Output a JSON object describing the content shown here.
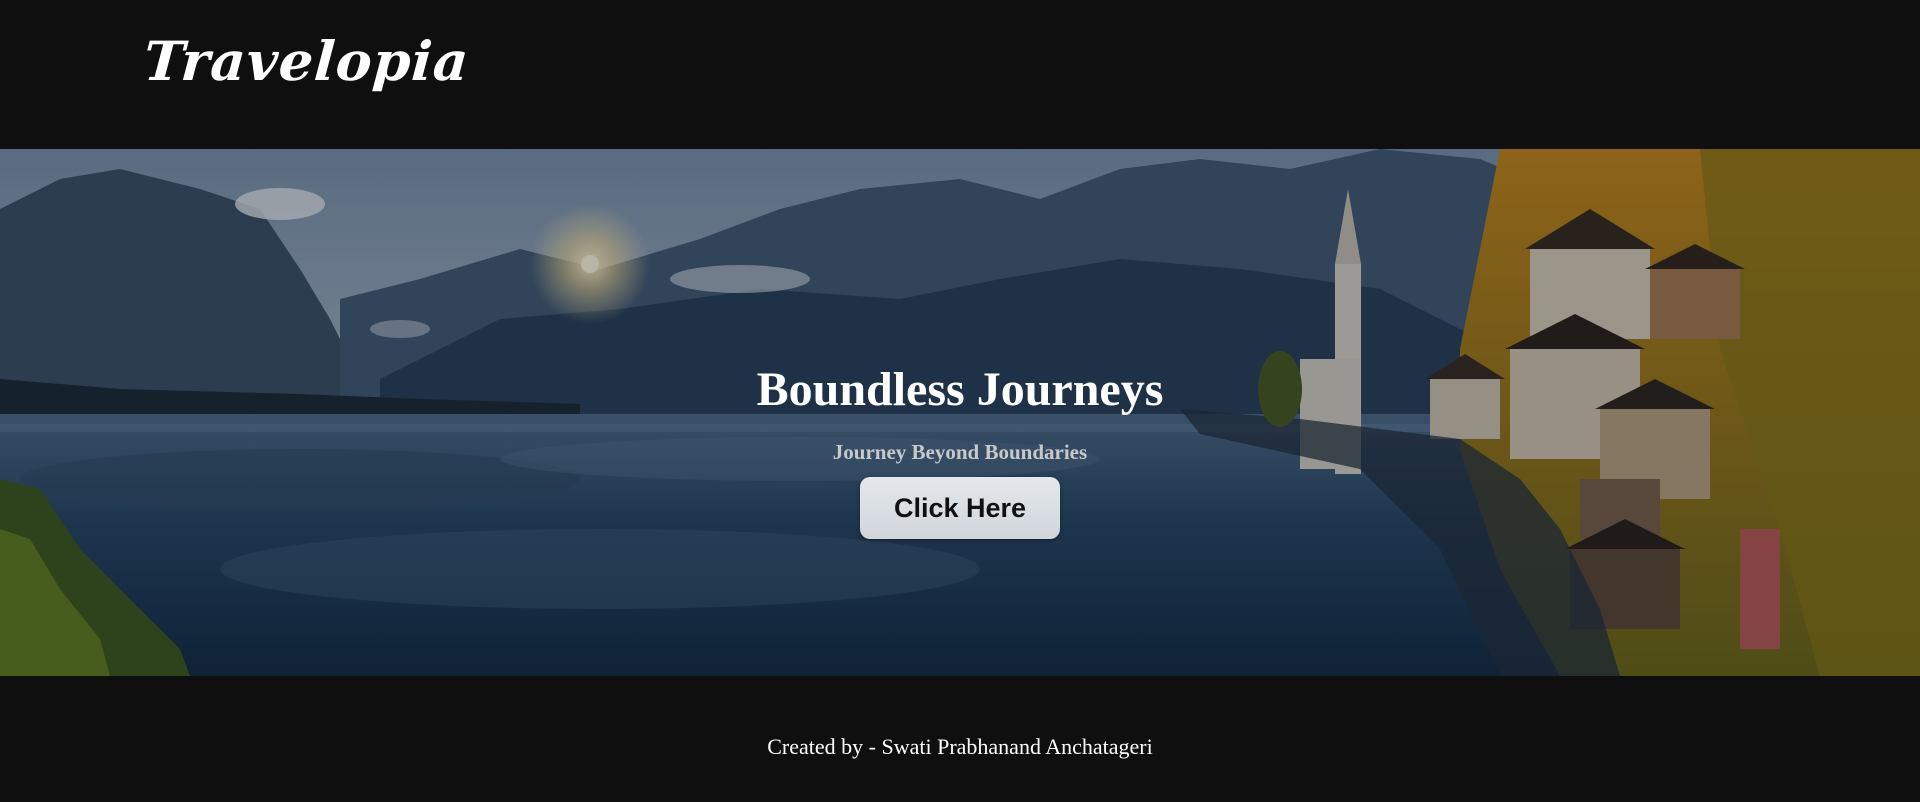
{
  "header": {
    "logo_text": "Travelopia"
  },
  "hero": {
    "title": "Boundless Journeys",
    "subtitle": "Journey Beyond Boundaries",
    "button_label": "Click Here",
    "background_image": "mountain-lake-village-landscape"
  },
  "footer": {
    "credit": "Created by - Swati Prabhanand Anchatageri"
  },
  "colors": {
    "page_background": "#0f0f0f",
    "text_primary": "#ffffff",
    "subtitle_text": "#c9c9c9",
    "button_background": "#dde2e7",
    "button_text": "#111111"
  }
}
